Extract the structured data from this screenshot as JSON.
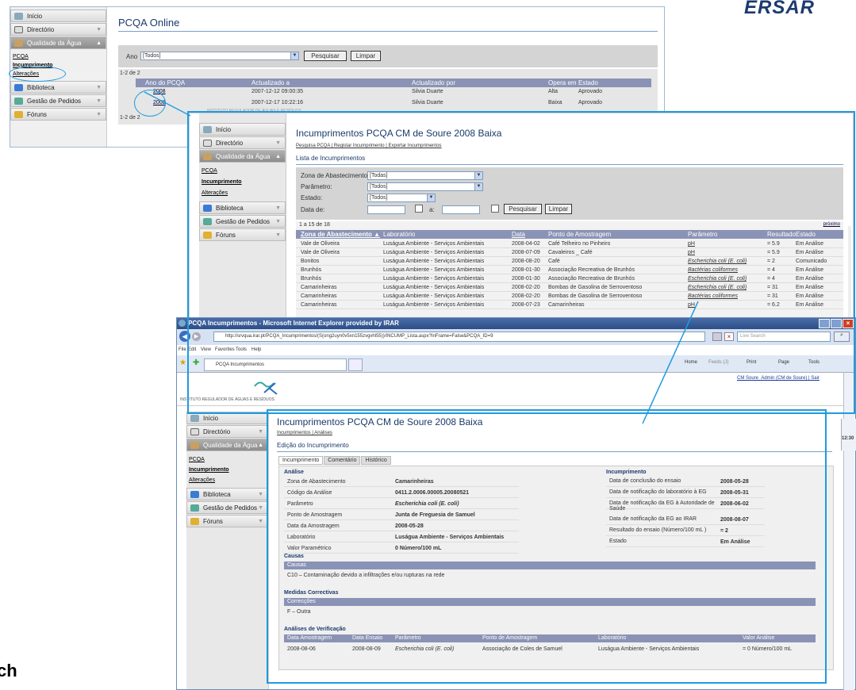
{
  "brand": "ERSAR",
  "bottom_fragment": "ch",
  "nav": {
    "inicio": "Início",
    "directorio": "Directório",
    "qualidade": "Qualidade da Água",
    "pcqa": "PCQA",
    "incumprimento": "Incumprimento",
    "alteracoes": "Alterações",
    "biblioteca": "Biblioteca",
    "gestao": "Gestão de Pedidos",
    "foruns": "Fóruns"
  },
  "w1": {
    "title": "PCQA Online",
    "ano_label": "Ano",
    "ano_value": "[Todos]",
    "search_btn": "Pesquisar",
    "clear_btn": "Limpar",
    "count": "1-2 de 2",
    "footer_count": "1-2 de 2",
    "faded_label": "INSTITUTO REGULADOR DE ÁGUAS E RESÍDUOS",
    "headers": [
      "Ano do PCQA",
      "Actualizado a",
      "Actualizado por",
      "Opera em",
      "Estado"
    ],
    "rows": [
      [
        "2008",
        "2007-12-12 09:00:35",
        "Silvia Duarte",
        "Alta",
        "Aprovado"
      ],
      [
        "2008",
        "2007-12-17 10:22:16",
        "Silvia Duarte",
        "Baixa",
        "Aprovado"
      ]
    ]
  },
  "w2": {
    "title": "Incumprimentos PCQA CM de Soure 2008 Baixa",
    "links": "Pesquisa PCQA | Registar Incumprimento | Exportar Incumprimentos",
    "subtitle": "Lista de Incumprimentos",
    "f_zona": "Zona de Abastecimento:",
    "f_zona_v": "[Todas]",
    "f_param": "Parâmetro:",
    "f_param_v": "[Todos]",
    "f_estado": "Estado:",
    "f_estado_v": "[Todos]",
    "f_data": "Data de:",
    "f_a": "a:",
    "search_btn": "Pesquisar",
    "clear_btn": "Limpar",
    "count": "1 a 15 de 18",
    "next": "próximo",
    "headers": [
      "Zona de Abastecimento ▲",
      "Laboratório",
      "Data",
      "Ponto de Amostragem",
      "Parâmetro",
      "Resultado",
      "Estado"
    ],
    "rows": [
      [
        "Vale de Oliveira",
        "Luságua Ambiente - Serviços Ambientais",
        "2008-04-02",
        "Café Telheiro no Pinheiro",
        "pH",
        "= 5.9",
        "Em Análise"
      ],
      [
        "Vale de Oliveira",
        "Luságua Ambiente - Serviços Ambientais",
        "2008-07-09",
        "Cavaleiros _ Café",
        "pH",
        "= 5.9",
        "Em Análise"
      ],
      [
        "Bonitos",
        "Luságua Ambiente - Serviços Ambientais",
        "2008-08-20",
        "Café",
        "Escherichia coli (E. coli)",
        "= 2",
        "Comunicado"
      ],
      [
        "Brunhós",
        "Luságua Ambiente - Serviços Ambientais",
        "2008-01-30",
        "Associação Recreativa de Brunhós",
        "Bactérias coliformes",
        "= 4",
        "Em Análise"
      ],
      [
        "Brunhós",
        "Luságua Ambiente - Serviços Ambientais",
        "2008-01-30",
        "Associação Recreativa de Brunhós",
        "Escherichia coli (E. coli)",
        "= 4",
        "Em Análise"
      ],
      [
        "Camarinheiras",
        "Luságua Ambiente - Serviços Ambientais",
        "2008-02-20",
        "Bombas de Gasolina de Serroventoso",
        "Escherichia coli (E. coli)",
        "= 31",
        "Em Análise"
      ],
      [
        "Camarinheiras",
        "Luságua Ambiente - Serviços Ambientais",
        "2008-02-20",
        "Bombas de Gasolina de Serroventoso",
        "Bactérias coliformes",
        "= 31",
        "Em Análise"
      ],
      [
        "Camarinheiras",
        "Luságua Ambiente - Serviços Ambientais",
        "2008-07-23",
        "Camarinheiras",
        "pH",
        "= 6.2",
        "Em Análise"
      ]
    ]
  },
  "ie": {
    "title": "PCQA Incumprimentos - Microsoft Internet Explorer provided by IRAR",
    "url": "http://srvqua.irar.pt/PCQA_Incumprimentos/(S(ong2uyn0v5xn155zvgvhl55))/INCUMP_Lista.aspx?InFrame=False&PCQA_ID=9",
    "live_search": "Live Search",
    "menu": [
      "File",
      "Edit",
      "View",
      "Favorites",
      "Tools",
      "Help"
    ],
    "tab": "PCQA Incumprimentos",
    "home": "Home",
    "feeds": "Feeds (J)",
    "print": "Print",
    "page": "Page",
    "tools": "Tools",
    "user_link": "CM Soure_Admin (CM de Soure) | Sair",
    "org": "INSTITUTO REGULADOR DE ÁGUAS E RESÍDUOS",
    "clock": "12:30"
  },
  "w3": {
    "title": "Incumprimentos PCQA CM de Soure 2008 Baixa",
    "links": "Incumprimentos | Análises",
    "subtitle": "Edição do Incumprimento",
    "tabs": [
      "Incumprimento",
      "Comentário",
      "Histórico"
    ],
    "analise_h": "Análise",
    "analise": [
      [
        "Zona de Abastecimento",
        "Camarinheiras"
      ],
      [
        "Código da Análise",
        "0411.2.0006.00005.20080521"
      ],
      [
        "Parâmetro",
        "Escherichia coli (E. coli)"
      ],
      [
        "Ponto de Amostragem",
        "Junta de Freguesia de Samuel"
      ],
      [
        "Data da Amostragem",
        "2008-05-28"
      ],
      [
        "Laboratório",
        "Luságua Ambiente - Serviços Ambientais"
      ],
      [
        "Valor Paramétrico",
        "0 Número/100 mL"
      ]
    ],
    "inc_h": "Incumprimento",
    "inc": [
      [
        "Data de conclusão do ensaio",
        "2008-05-28"
      ],
      [
        "Data de notificação do laboratório à EG",
        "2008-05-31"
      ],
      [
        "Data de notificação da EG à Autoridade de Saúde",
        "2008-06-02"
      ],
      [
        "Data de notificação da EG ao IRAR",
        "2008-08-07"
      ],
      [
        "Resultado do ensaio (Número/100 mL )",
        "= 2"
      ],
      [
        "Estado",
        "Em Análise"
      ]
    ],
    "causas_h": "Causas",
    "causas_bar": "Causas",
    "causa": "C10 – Contaminação devido a infiltrações e/ou rupturas na rede",
    "medidas_h": "Medidas Correctivas",
    "medidas_bar": "Correcções",
    "medida": "F – Outra",
    "verif_h": "Análises de Verificação",
    "verif_headers": [
      "Data Amostragem",
      "Data Ensaio",
      "Parâmetro",
      "Ponto de Amostragem",
      "Laboratório",
      "Valor Análise"
    ],
    "verif_row": [
      "2008-08-06",
      "2008-08-09",
      "Escherichia coli (E. coli)",
      "Associação de Coles de Samuel",
      "Luságua Ambiente - Serviços Ambientais",
      "= 0 Número/100 mL"
    ]
  }
}
